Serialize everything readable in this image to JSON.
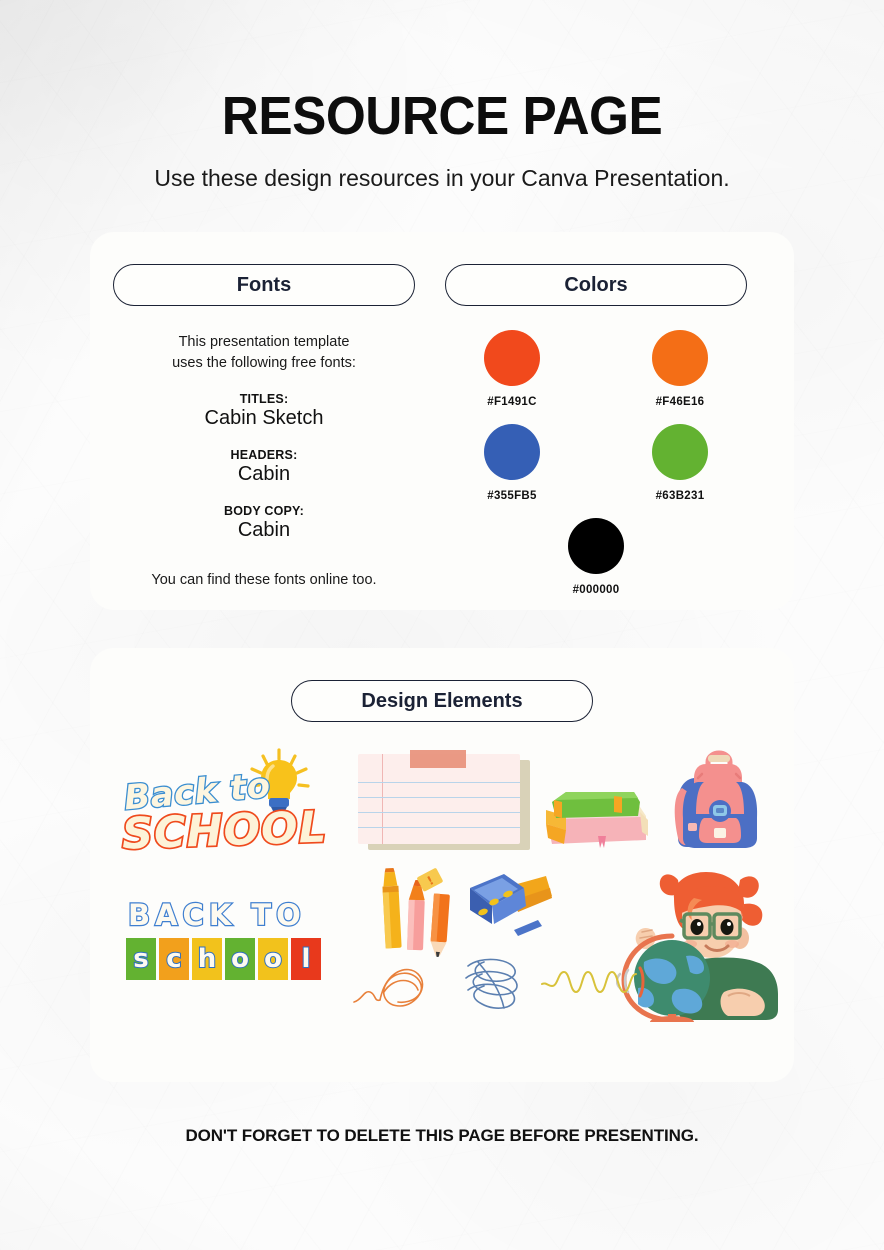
{
  "header": {
    "title": "RESOURCE PAGE",
    "subtitle": "Use these design resources in your Canva Presentation."
  },
  "fonts": {
    "heading": "Fonts",
    "intro_line1": "This presentation template",
    "intro_line2": "uses the following free fonts:",
    "entries": [
      {
        "role": "TITLES:",
        "name": "Cabin Sketch"
      },
      {
        "role": "HEADERS:",
        "name": "Cabin"
      },
      {
        "role": "BODY COPY:",
        "name": "Cabin"
      }
    ],
    "outro": "You can find these fonts online too."
  },
  "colors": {
    "heading": "Colors",
    "swatches": [
      {
        "hex_label": "#F1491C",
        "hex": "#F1491C"
      },
      {
        "hex_label": "#F46E16",
        "hex": "#F46E16"
      },
      {
        "hex_label": "#355FB5",
        "hex": "#355FB5"
      },
      {
        "hex_label": "#63B231",
        "hex": "#63B231"
      },
      {
        "hex_label": "#000000",
        "hex": "#000000"
      }
    ]
  },
  "design_elements": {
    "heading": "Design Elements",
    "items": [
      {
        "name": "back-to-school-bulb-sticker",
        "line1": "Back to",
        "line2": "SCHOOL"
      },
      {
        "name": "notebook-paper-sticker"
      },
      {
        "name": "book-stack-sticker"
      },
      {
        "name": "backpack-sticker"
      },
      {
        "name": "back-to-school-tiles-sticker",
        "line1": "BACK TO",
        "tiles": [
          "s",
          "c",
          "h",
          "o",
          "o",
          "l"
        ]
      },
      {
        "name": "pencils-sticker"
      },
      {
        "name": "blue-book-case-sticker"
      },
      {
        "name": "globe-girl-illustration"
      },
      {
        "name": "orange-loop-doodle"
      },
      {
        "name": "blue-spiral-doodle"
      },
      {
        "name": "yellow-wave-doodle"
      }
    ],
    "tile_colors": [
      "#63B231",
      "#F2A01C",
      "#F2C21C",
      "#63B231",
      "#F2C21C",
      "#E8391C"
    ]
  },
  "footer": {
    "note": "DON'T FORGET TO DELETE THIS PAGE BEFORE PRESENTING."
  }
}
